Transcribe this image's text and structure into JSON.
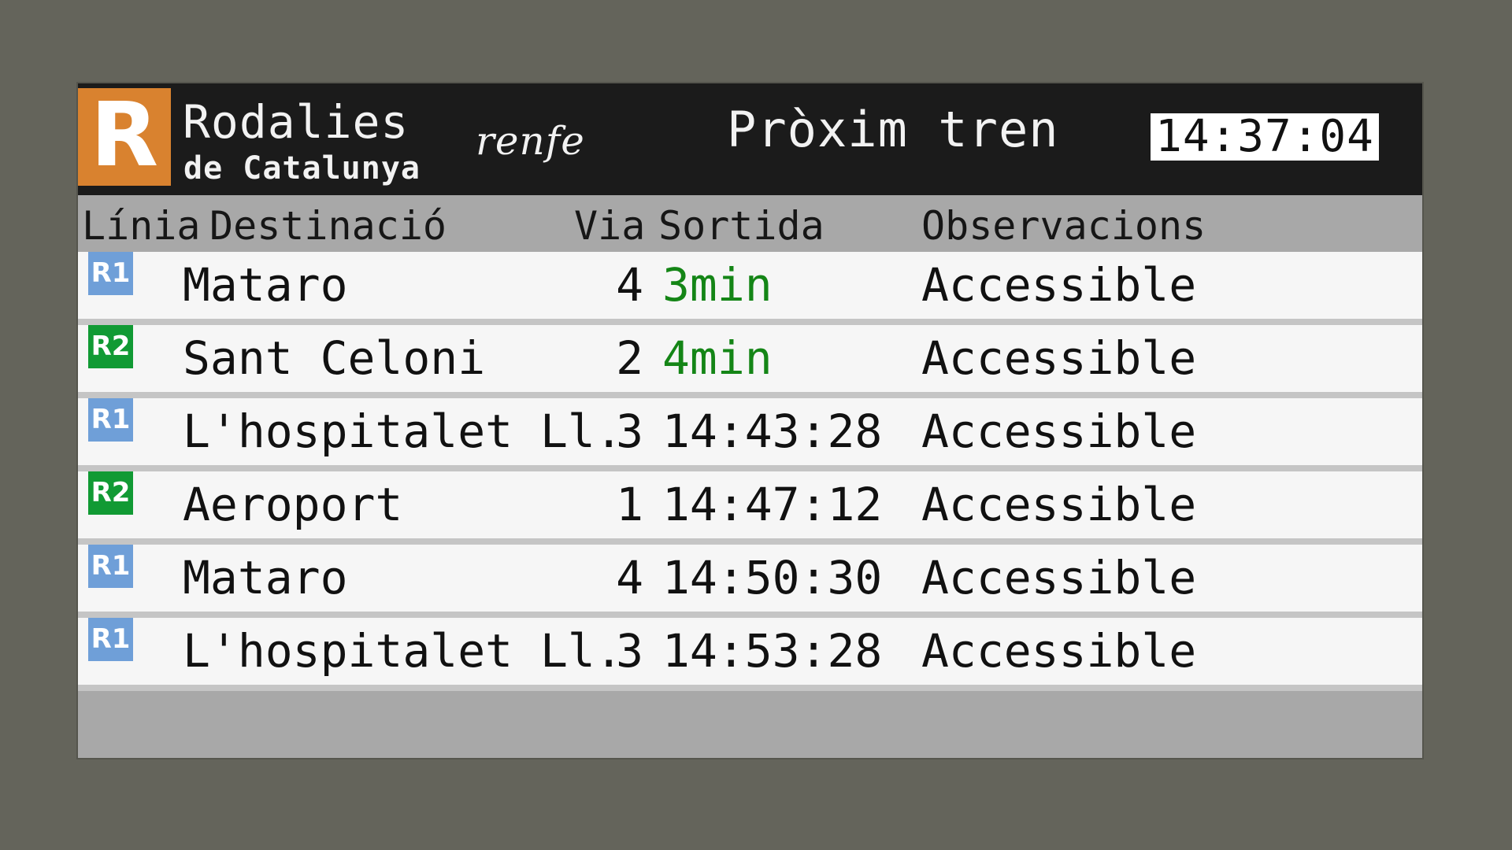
{
  "header": {
    "logo_letter": "R",
    "brand_main": "Rodalies",
    "brand_sub": "de Catalunya",
    "operator": "renfe",
    "title": "Pròxim tren",
    "clock": "14:37:04"
  },
  "columns": {
    "line": "Línia",
    "destination": "Destinació",
    "platform": "Via",
    "departure": "Sortida",
    "remarks": "Observacions"
  },
  "departures": [
    {
      "line": "R1",
      "destination": "Mataro",
      "platform": "4",
      "departure": "3min",
      "remarks": "Accessible"
    },
    {
      "line": "R2",
      "destination": "Sant Celoni",
      "platform": "2",
      "departure": "4min",
      "remarks": "Accessible"
    },
    {
      "line": "R1",
      "destination": "L'hospitalet Ll.",
      "platform": "3",
      "departure": "14:43:28",
      "remarks": "Accessible"
    },
    {
      "line": "R2",
      "destination": "Aeroport",
      "platform": "1",
      "departure": "14:47:12",
      "remarks": "Accessible"
    },
    {
      "line": "R1",
      "destination": "Mataro",
      "platform": "4",
      "departure": "14:50:30",
      "remarks": "Accessible"
    },
    {
      "line": "R1",
      "destination": "L'hospitalet Ll.",
      "platform": "3",
      "departure": "14:53:28",
      "remarks": "Accessible"
    }
  ],
  "colors": {
    "background": "#64645b",
    "header": "#1b1b1b",
    "logo_orange": "#d9822f",
    "row": "#f6f6f6",
    "r1": "#6f9fd8",
    "r2": "#119a34",
    "soon": "#148516",
    "text": "#111111"
  }
}
